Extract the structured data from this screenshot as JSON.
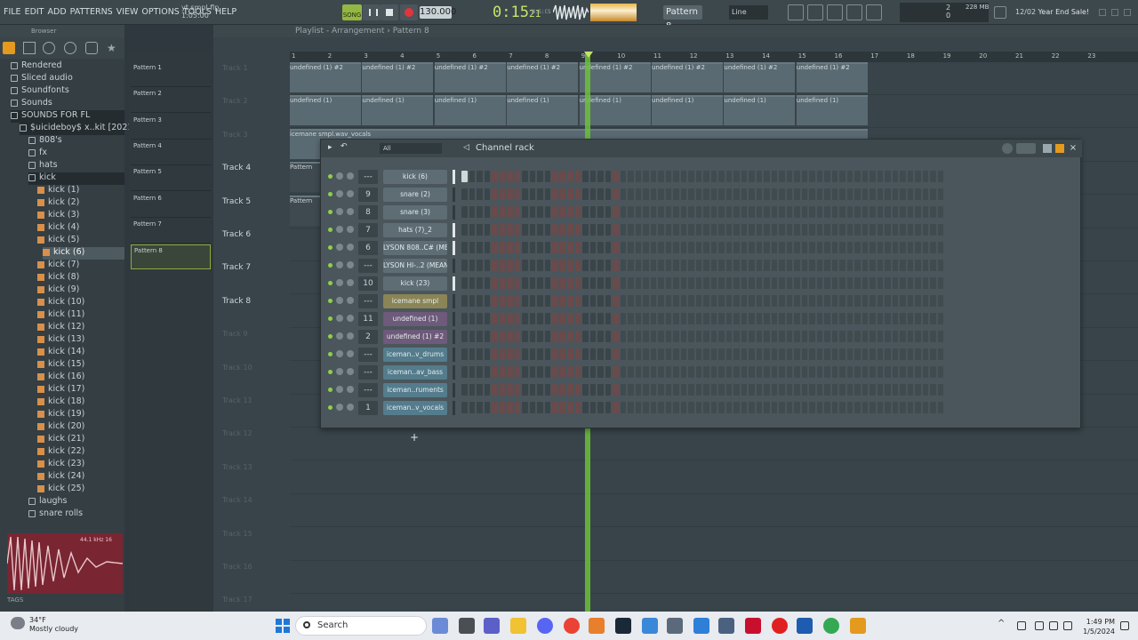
{
  "menu": [
    "FILE",
    "EDIT",
    "ADD",
    "PATTERNS",
    "VIEW",
    "OPTIONS",
    "TOOLS",
    "HELP"
  ],
  "file": {
    "name": "yt smpl.flp",
    "time": "1:05:00"
  },
  "transport": {
    "mode_label": "SONG",
    "tempo": "130.000",
    "time": "0:15",
    "time_frac": "21",
    "time_unit": "M:S:CS"
  },
  "pattern_selector": "Pattern 8",
  "snap": "Line",
  "cpu": "2",
  "voices": "0",
  "memory": "228 MB",
  "news": {
    "date": "12/02",
    "text": "Year End Sale!"
  },
  "browser": {
    "title": "Browser",
    "items": [
      {
        "label": "Rendered",
        "type": "folder"
      },
      {
        "label": "Sliced audio",
        "type": "folder"
      },
      {
        "label": "Soundfonts",
        "type": "folder"
      },
      {
        "label": "Sounds",
        "type": "folder"
      },
      {
        "label": "SOUNDS FOR FL",
        "type": "folder"
      },
      {
        "label": "$uicideboy$ x..kit  [2021]",
        "type": "folder"
      },
      {
        "label": "808's",
        "type": "folder"
      },
      {
        "label": "fx",
        "type": "folder"
      },
      {
        "label": "hats",
        "type": "folder"
      },
      {
        "label": "kick",
        "type": "folder"
      },
      {
        "label": "kick (1)",
        "type": "file"
      },
      {
        "label": "kick (2)",
        "type": "file"
      },
      {
        "label": "kick (3)",
        "type": "file"
      },
      {
        "label": "kick (4)",
        "type": "file"
      },
      {
        "label": "kick (5)",
        "type": "file"
      },
      {
        "label": "kick (6)",
        "type": "file"
      },
      {
        "label": "kick (7)",
        "type": "file"
      },
      {
        "label": "kick (8)",
        "type": "file"
      },
      {
        "label": "kick (9)",
        "type": "file"
      },
      {
        "label": "kick (10)",
        "type": "file"
      },
      {
        "label": "kick (11)",
        "type": "file"
      },
      {
        "label": "kick (12)",
        "type": "file"
      },
      {
        "label": "kick (13)",
        "type": "file"
      },
      {
        "label": "kick (14)",
        "type": "file"
      },
      {
        "label": "kick (15)",
        "type": "file"
      },
      {
        "label": "kick (16)",
        "type": "file"
      },
      {
        "label": "kick (17)",
        "type": "file"
      },
      {
        "label": "kick (18)",
        "type": "file"
      },
      {
        "label": "kick (19)",
        "type": "file"
      },
      {
        "label": "kick (20)",
        "type": "file"
      },
      {
        "label": "kick (21)",
        "type": "file"
      },
      {
        "label": "kick (22)",
        "type": "file"
      },
      {
        "label": "kick (23)",
        "type": "file"
      },
      {
        "label": "kick (24)",
        "type": "file"
      },
      {
        "label": "kick (25)",
        "type": "file"
      },
      {
        "label": "laughs",
        "type": "folder"
      },
      {
        "label": "snare rolls",
        "type": "folder"
      }
    ],
    "preview_info": "44.1 kHz 16",
    "tags_label": "TAGS"
  },
  "patterns": [
    "Pattern 1",
    "Pattern 2",
    "Pattern 3",
    "Pattern 4",
    "Pattern 5",
    "Pattern 6",
    "Pattern 7",
    "Pattern 8"
  ],
  "playlist": {
    "title": "Playlist - Arrangement",
    "pattern": "Pattern 8",
    "ticks": [
      "1",
      "2",
      "3",
      "4",
      "5",
      "6",
      "7",
      "8",
      "9",
      "10",
      "11",
      "12",
      "13",
      "14",
      "15",
      "16",
      "17",
      "18",
      "19",
      "20",
      "21",
      "22",
      "23"
    ],
    "tracks": [
      "Track 1",
      "Track 2",
      "Track 3",
      "Track 4",
      "Track 5",
      "Track 6",
      "Track 7",
      "Track 8",
      "Track 9",
      "Track 10",
      "Track 11",
      "Track 12",
      "Track 13",
      "Track 14",
      "Track 15",
      "Track 16",
      "Track 17"
    ],
    "clip_label_1": "undefined (1) #2",
    "clip_label_2": "undefined (1)",
    "clip_label_3": "icemane smpl.wav_vocals",
    "clip_pattern": "Pattern"
  },
  "rack": {
    "title": "Channel rack",
    "filter": "All",
    "channels": [
      {
        "route": "---",
        "name": "kick (6)",
        "style": "plain",
        "vol_on": true
      },
      {
        "route": "9",
        "name": "snare (2)",
        "style": "plain",
        "vol_on": false
      },
      {
        "route": "8",
        "name": "snare (3)",
        "style": "plain",
        "vol_on": false
      },
      {
        "route": "7",
        "name": "hats (7)_2",
        "style": "plain",
        "vol_on": true
      },
      {
        "route": "6",
        "name": "LYSON 808..C# (MEAN)",
        "style": "plain",
        "vol_on": true
      },
      {
        "route": "---",
        "name": "LYSON HI-..2 (MEAN)",
        "style": "plain",
        "vol_on": false
      },
      {
        "route": "10",
        "name": "kick (23)",
        "style": "plain",
        "vol_on": true
      },
      {
        "route": "---",
        "name": "icemane smpl",
        "style": "tan",
        "vol_on": false
      },
      {
        "route": "11",
        "name": "undefined (1)",
        "style": "purple",
        "vol_on": false
      },
      {
        "route": "2",
        "name": "undefined (1) #2",
        "style": "purple",
        "vol_on": false
      },
      {
        "route": "---",
        "name": "iceman..v_drums",
        "style": "blue",
        "vol_on": false
      },
      {
        "route": "---",
        "name": "iceman..av_bass",
        "style": "blue",
        "vol_on": false
      },
      {
        "route": "---",
        "name": "iceman..ruments",
        "style": "blue",
        "vol_on": false
      },
      {
        "route": "1",
        "name": "iceman..v_vocals",
        "style": "blue",
        "vol_on": false
      }
    ],
    "add_label": "+"
  },
  "taskbar": {
    "temp": "34°F",
    "condition": "Mostly cloudy",
    "search": "Search",
    "time": "1:49 PM",
    "date": "1/5/2024"
  }
}
